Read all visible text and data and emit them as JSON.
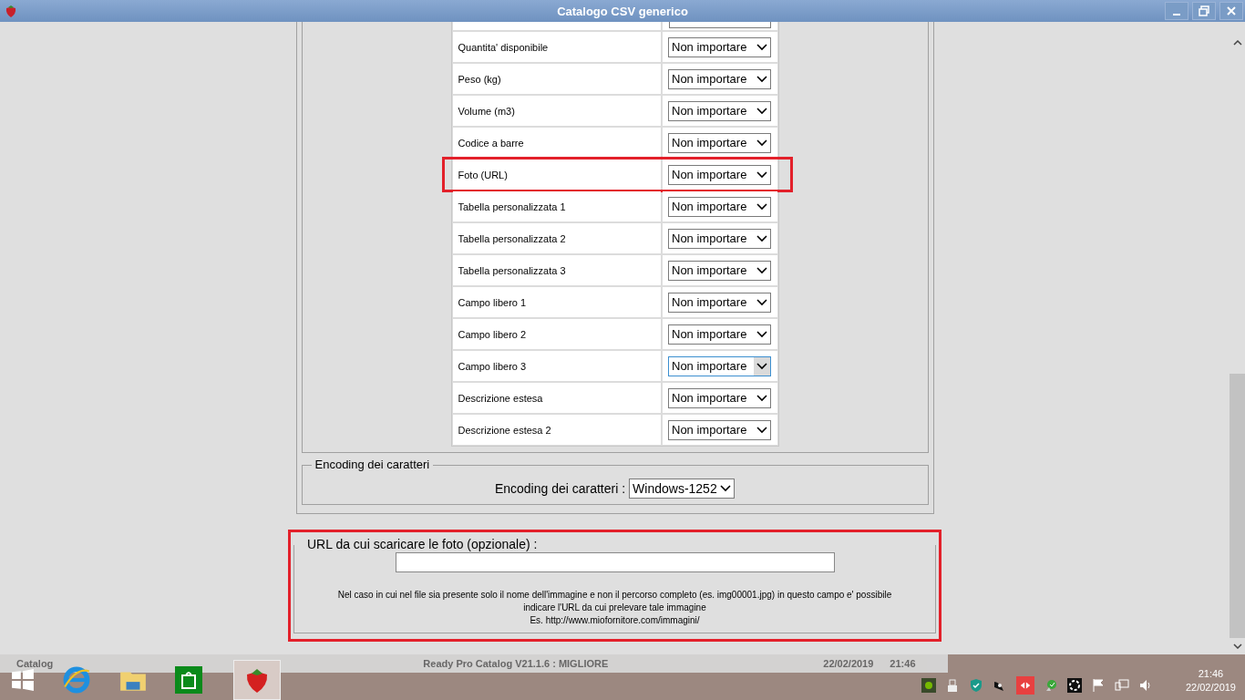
{
  "window": {
    "title": "Catalogo CSV generico"
  },
  "mapping_rows": [
    {
      "label": "Quantita' disponibile",
      "value": "Non importare",
      "focused": false,
      "highlighted": false
    },
    {
      "label": "Peso (kg)",
      "value": "Non importare",
      "focused": false,
      "highlighted": false
    },
    {
      "label": "Volume (m3)",
      "value": "Non importare",
      "focused": false,
      "highlighted": false
    },
    {
      "label": "Codice a barre",
      "value": "Non importare",
      "focused": false,
      "highlighted": false
    },
    {
      "label": "Foto (URL)",
      "value": "Non importare",
      "focused": false,
      "highlighted": true
    },
    {
      "label": "Tabella personalizzata 1",
      "value": "Non importare",
      "focused": false,
      "highlighted": false
    },
    {
      "label": "Tabella personalizzata 2",
      "value": "Non importare",
      "focused": false,
      "highlighted": false
    },
    {
      "label": "Tabella personalizzata 3",
      "value": "Non importare",
      "focused": false,
      "highlighted": false
    },
    {
      "label": "Campo libero 1",
      "value": "Non importare",
      "focused": false,
      "highlighted": false
    },
    {
      "label": "Campo libero 2",
      "value": "Non importare",
      "focused": false,
      "highlighted": false
    },
    {
      "label": "Campo libero 3",
      "value": "Non importare",
      "focused": true,
      "highlighted": false
    },
    {
      "label": "Descrizione estesa",
      "value": "Non importare",
      "focused": false,
      "highlighted": false
    },
    {
      "label": "Descrizione estesa 2",
      "value": "Non importare",
      "focused": false,
      "highlighted": false
    }
  ],
  "encoding": {
    "legend": "Encoding dei caratteri",
    "label": "Encoding dei caratteri :",
    "value": "Windows-1252"
  },
  "photo_url": {
    "legend": "URL da cui scaricare le foto (opzionale) :",
    "highlighted": true,
    "help_lines": [
      "Nel caso in cui nel file sia presente solo il nome dell'immagine e non il percorso completo (es. img00001.jpg) in questo campo e' possibile",
      "indicare l'URL da cui prelevare tale immagine",
      "Es. http://www.miofornitore.com/immagini/"
    ]
  },
  "status_bar": {
    "module": "Catalog",
    "version": "Ready Pro Catalog V21.1.6 : MIGLIORE",
    "date": "22/02/2019",
    "time": "21:46"
  },
  "taskbar": {
    "clock_time": "21:46",
    "clock_date": "22/02/2019"
  }
}
